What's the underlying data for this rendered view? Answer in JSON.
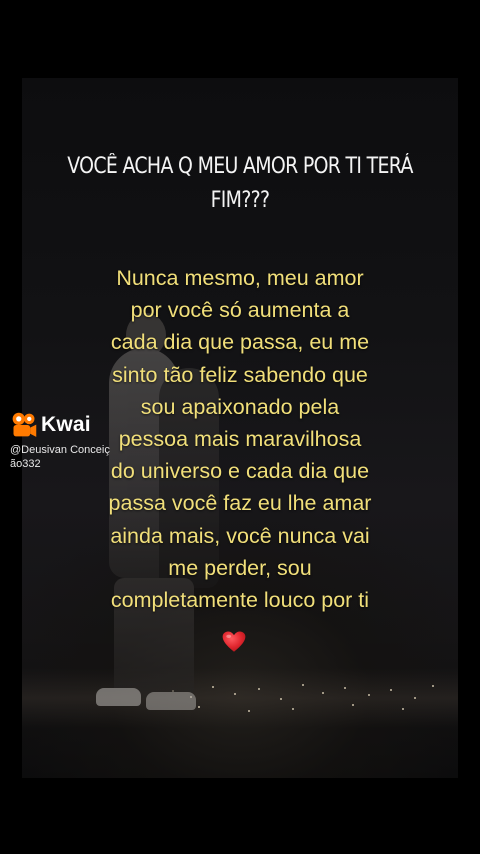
{
  "question": {
    "lines": [
      "VOCÊ ACHA Q MEU AMOR POR TI TERÁ",
      "FIM???"
    ]
  },
  "message": {
    "lines": [
      "Nunca mesmo, meu amor",
      "por você só aumenta a",
      "cada dia que passa, eu me",
      "sinto tão feliz sabendo que",
      "sou apaixonado pela",
      "pessoa mais maravilhosa",
      "do universo e cada dia que",
      "passa você faz eu lhe amar",
      "ainda mais, você nunca vai",
      "me perder, sou",
      "completamente louco por ti"
    ],
    "emoji": "heart-emoji"
  },
  "watermark": {
    "brand": "Kwai",
    "icon": "kwai-logo-icon",
    "username_lines": [
      "@Deusivan Conceiç",
      "ão332"
    ]
  },
  "colors": {
    "message_text": "#f1df7a",
    "question_text": "#f4f4f4",
    "heart": "#e0262e",
    "kwai_orange": "#ff7a00"
  }
}
